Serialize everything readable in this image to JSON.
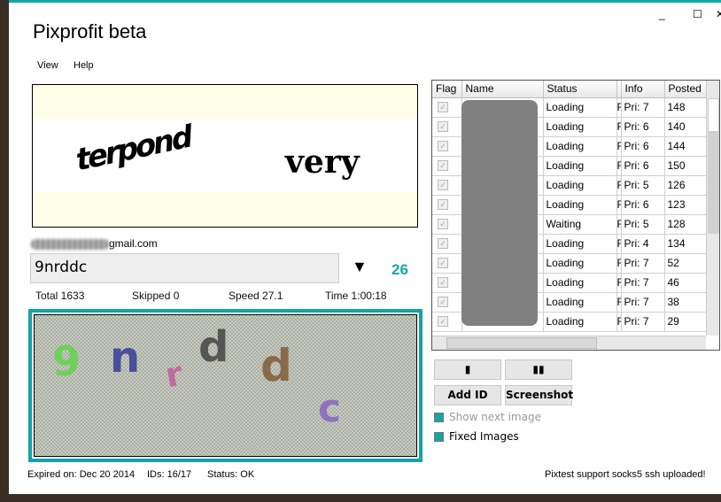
{
  "window": {
    "title": "Pixprofit beta",
    "controls": [
      "_",
      "☐",
      "✕"
    ],
    "accent": "#13a8a8"
  },
  "menu": [
    "View",
    "Help"
  ],
  "captcha": {
    "word1": "terpond",
    "word2": "very"
  },
  "account": {
    "email_suffix": "gmail.com"
  },
  "answer": {
    "value": "9nrddc",
    "dropdown_icon": "▼",
    "count": "26"
  },
  "stats": {
    "total": "Total 1633",
    "skipped": "Skipped 0",
    "speed": "Speed 27.1",
    "time": "Time 1:00:18"
  },
  "preview_chars": [
    "9",
    "n",
    "r",
    "d",
    "d",
    "c"
  ],
  "footer": {
    "expired": "Expired on: Dec 20 2014",
    "ids": "IDs: 16/17",
    "status": "Status: OK",
    "message": "Pixtest support socks5  ssh uploaded!"
  },
  "grid": {
    "columns": [
      "Flag",
      "Name",
      "Status",
      "",
      "Info",
      "Posted"
    ],
    "rows": [
      {
        "status": "Loading",
        "x": "F",
        "info": "Pri: 7",
        "posted": "148"
      },
      {
        "status": "Loading",
        "x": "F",
        "info": "Pri: 6",
        "posted": "140"
      },
      {
        "status": "Loading",
        "x": "F",
        "info": "Pri: 6",
        "posted": "144"
      },
      {
        "status": "Loading",
        "x": "F",
        "info": "Pri: 6",
        "posted": "150"
      },
      {
        "status": "Loading",
        "x": "F",
        "info": "Pri: 5",
        "posted": "126"
      },
      {
        "status": "Loading",
        "x": "F",
        "info": "Pri: 6",
        "posted": "123"
      },
      {
        "status": "Waiting",
        "x": "F",
        "info": "Pri: 5",
        "posted": "128"
      },
      {
        "status": "Loading",
        "x": "F",
        "info": "Pri: 4",
        "posted": "134"
      },
      {
        "status": "Loading",
        "x": "F",
        "info": "Pri: 7",
        "posted": "52"
      },
      {
        "status": "Loading",
        "x": "F",
        "info": "Pri: 7",
        "posted": "46"
      },
      {
        "status": "Loading",
        "x": "F",
        "info": "Pri: 7",
        "posted": "38"
      },
      {
        "status": "Loading",
        "x": "F",
        "info": "Pri: 7",
        "posted": "29"
      }
    ]
  },
  "buttons": {
    "start": "▮",
    "pause": "▮▮",
    "add_id": "Add ID",
    "screenshot": "Screenshot"
  },
  "options": {
    "show_next": "Show next image",
    "fixed_images": "Fixed Images"
  }
}
